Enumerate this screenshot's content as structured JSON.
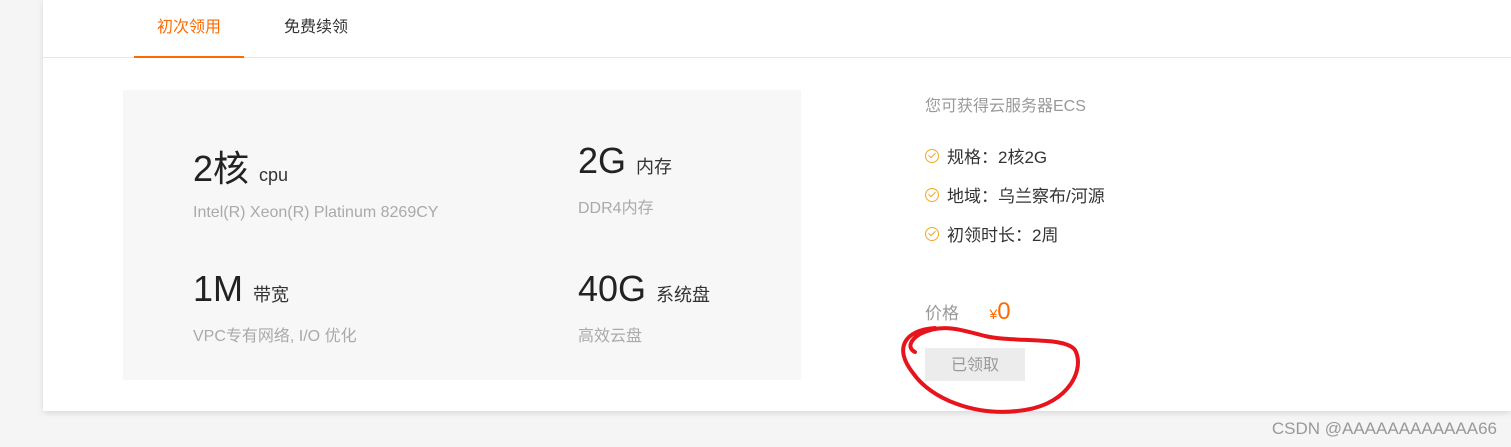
{
  "tabs": [
    {
      "label": "初次领用",
      "active": true
    },
    {
      "label": "免费续领",
      "active": false
    }
  ],
  "specs": {
    "cpu": {
      "value": "2核",
      "unit": "cpu",
      "detail": "Intel(R) Xeon(R) Platinum 8269CY"
    },
    "memory": {
      "value": "2G",
      "unit": "内存",
      "detail": "DDR4内存"
    },
    "bandwidth": {
      "value": "1M",
      "unit": "带宽",
      "detail": "VPC专有网络, I/O 优化"
    },
    "disk": {
      "value": "40G",
      "unit": "系统盘",
      "detail": "高效云盘"
    }
  },
  "info": {
    "title": "您可获得云服务器ECS",
    "items": [
      {
        "text": "规格：2核2G",
        "icon": "check-circle-icon"
      },
      {
        "text": "地域：乌兰察布/河源",
        "icon": "check-circle-icon"
      },
      {
        "text": "初领时长：2周",
        "icon": "check-circle-icon"
      }
    ]
  },
  "price": {
    "label": "价格",
    "currency": "¥",
    "value": "0"
  },
  "claim_button": {
    "label": "已领取",
    "disabled": true
  },
  "watermark": "CSDN @AAAAAAAAAAAA66",
  "colors": {
    "accent": "#ff6a00",
    "check": "#f5a623",
    "annotation": "#e8141c"
  }
}
